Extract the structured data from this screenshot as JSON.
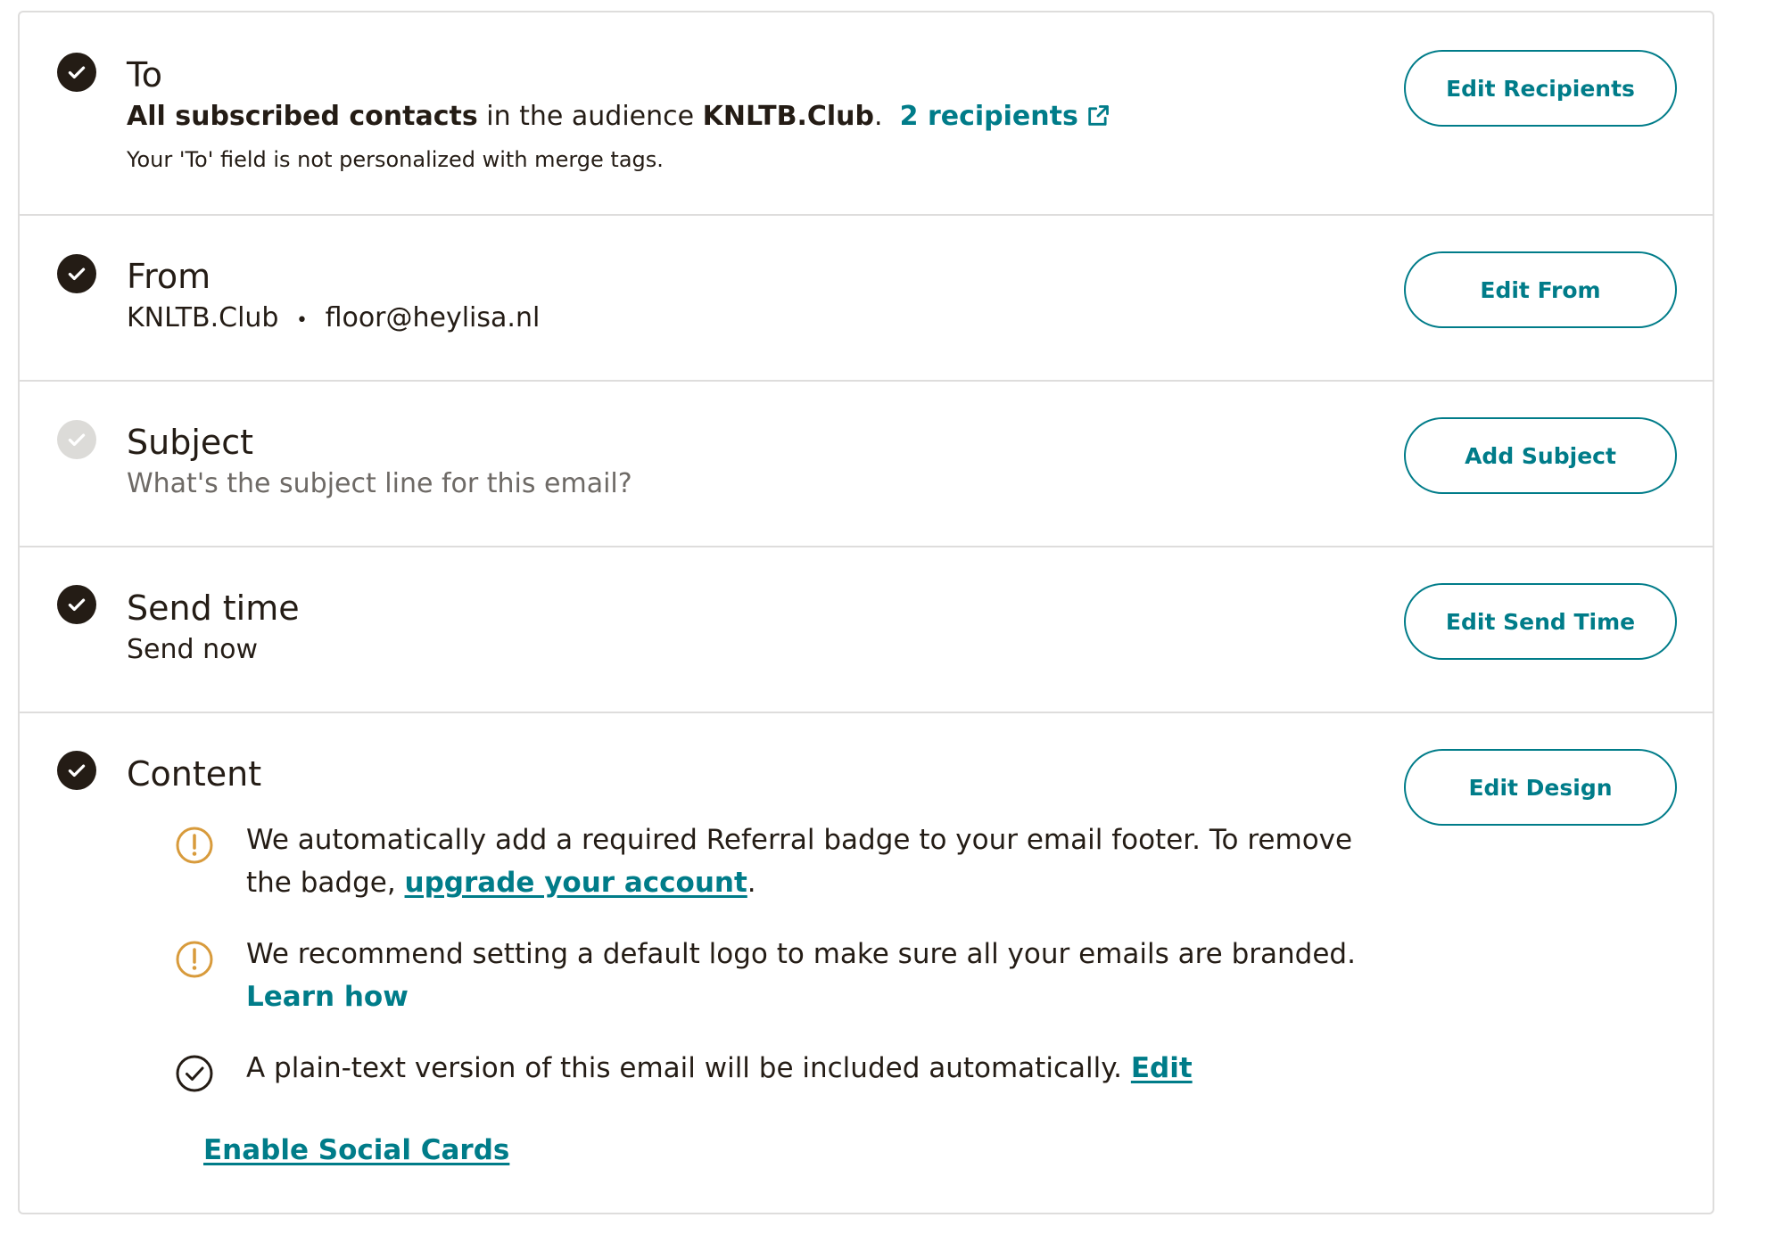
{
  "to": {
    "title": "To",
    "prefix_bold": "All subscribed contacts",
    "middle": " in the audience ",
    "audience_bold": "KNLTB.Club",
    "suffix": ".",
    "recipients_link": "2 recipients",
    "note": "Your 'To' field is not personalized with merge tags.",
    "button": "Edit Recipients"
  },
  "from": {
    "title": "From",
    "name": "KNLTB.Club",
    "separator": "•",
    "email": "floor@heylisa.nl",
    "button": "Edit From"
  },
  "subject": {
    "title": "Subject",
    "placeholder": "What's the subject line for this email?",
    "button": "Add Subject"
  },
  "send_time": {
    "title": "Send time",
    "value": "Send now",
    "button": "Edit Send Time"
  },
  "content": {
    "title": "Content",
    "button": "Edit Design",
    "notes": [
      {
        "text": "We automatically add a required Referral badge to your email footer. To remove the badge, ",
        "link": "upgrade your account",
        "after": "."
      },
      {
        "text": "We recommend setting a default logo to make sure all your emails are branded.",
        "link": "Learn how"
      },
      {
        "text": "A plain-text version of this email will be included automatically. ",
        "link": "Edit"
      }
    ],
    "social_cards_link": "Enable Social Cards"
  },
  "colors": {
    "accent": "#007c89",
    "warning": "#d89b3c",
    "text": "#241c15",
    "pending": "#dcdbd8"
  },
  "icons": [
    "check-circle-icon",
    "warning-icon",
    "external-link-icon"
  ]
}
